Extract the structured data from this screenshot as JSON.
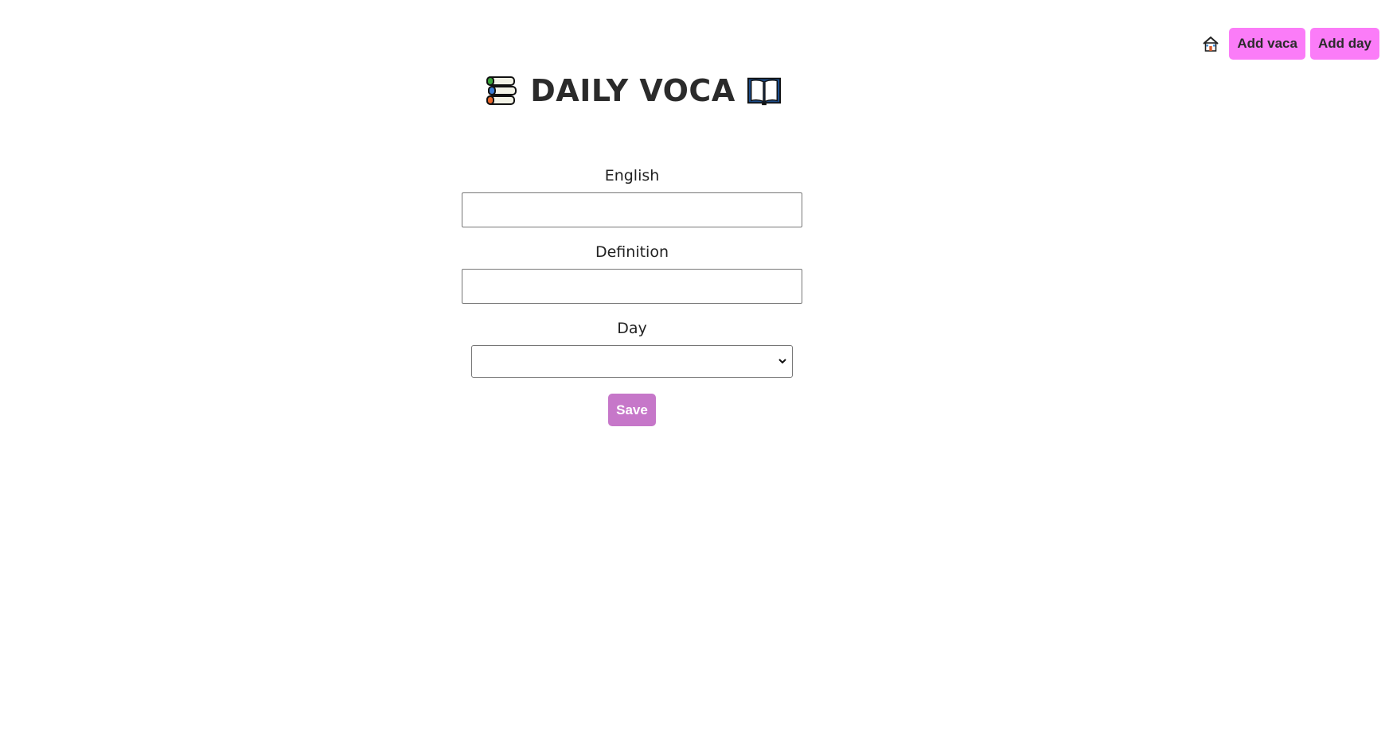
{
  "nav": {
    "home_icon": "house-icon",
    "add_vaca_label": "Add vaca",
    "add_day_label": "Add day"
  },
  "header": {
    "left_icon": "books-icon",
    "title": "DAILY VOCA",
    "right_icon": "open-book-icon"
  },
  "form": {
    "english_label": "English",
    "english_value": "",
    "definition_label": "Definition",
    "definition_value": "",
    "day_label": "Day",
    "day_selected": "",
    "save_label": "Save"
  },
  "colors": {
    "nav_button_bg": "#fb7cf8",
    "save_button_bg": "#c677c9",
    "text": "#2b2b2b"
  }
}
